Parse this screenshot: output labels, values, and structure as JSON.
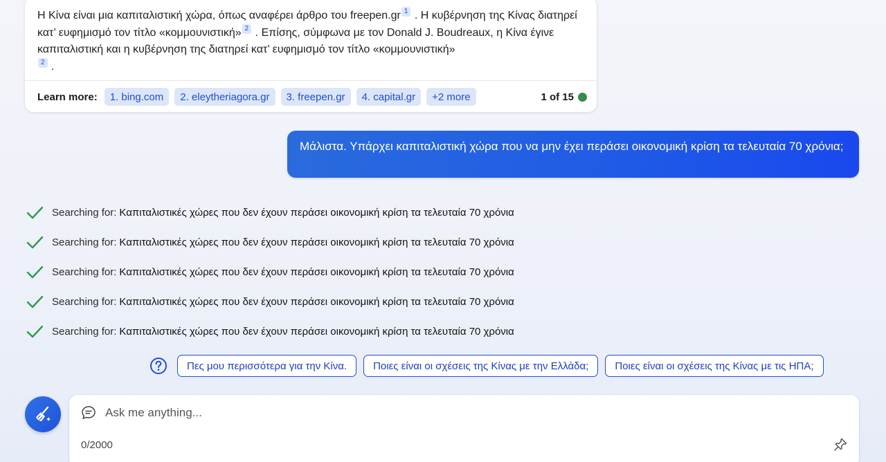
{
  "answer": {
    "text_1": "Η Κίνα είναι μια καπιταλιστική χώρα, όπως αναφέρει άρθρο του ",
    "source_inline_1": "freepen.gr",
    "cite_1": "1",
    "text_2": " . Η κυβέρνηση της Κίνας διατηρεί κατ’ ευφημισμό τον τίτλο «κομμουνιστική»",
    "cite_2": "2",
    "text_3": " . Επίσης, σύμφωνα με τον ",
    "author": "Donald J. Boudreaux",
    "text_4": ", η Κίνα έγινε καπιταλιστική και η κυβέρνηση της διατηρεί κατ’ ευφημισμό τον τίτλο «κομμουνιστική»",
    "cite_3": "2",
    "text_5": " .",
    "learn_more_label": "Learn more:",
    "sources": [
      "1. bing.com",
      "2. eleytheriagora.gr",
      "3. freepen.gr",
      "4. capital.gr",
      "+2 more"
    ],
    "page_count": "1 of 15",
    "status_color": "#3a8a4e"
  },
  "user_message": "Μάλιστα. Υπάρχει καπιταλιστική χώρα που να μην έχει περάσει οικονομική κρίση τα τελευταία 70 χρόνια;",
  "searches": [
    {
      "prefix": "Searching for:",
      "query": "Καπιταλιστικές χώρες που δεν έχουν περάσει οικονομική κρίση τα τελευταία 70 χρόνια"
    },
    {
      "prefix": "Searching for:",
      "query": "Καπιταλιστικές χώρες που δεν έχουν περάσει οικονομική κρίση τα τελευταία 70 χρόνια"
    },
    {
      "prefix": "Searching for:",
      "query": "Καπιταλιστικές χώρες που δεν έχουν περάσει οικονομική κρίση τα τελευταία 70 χρόνια"
    },
    {
      "prefix": "Searching for:",
      "query": "Καπιταλιστικές χώρες που δεν έχουν περάσει οικονομική κρίση τα τελευταία 70 χρόνια"
    },
    {
      "prefix": "Searching for:",
      "query": "Καπιταλιστικές χώρες που δεν έχουν περάσει οικονομική κρίση τα τελευταία 70 χρόνια"
    }
  ],
  "suggestions": [
    "Πες μου περισσότερα για την Κίνα.",
    "Ποιες είναι οι σχέσεις της Κίνας με την Ελλάδα;",
    "Ποιες είναι οι σχέσεις της Κίνας με τις ΗΠΑ;"
  ],
  "composer": {
    "placeholder": "Ask me anything...",
    "char_count": "0/2000"
  },
  "colors": {
    "accent": "#1f5ae6",
    "check": "#2e9a4a"
  }
}
